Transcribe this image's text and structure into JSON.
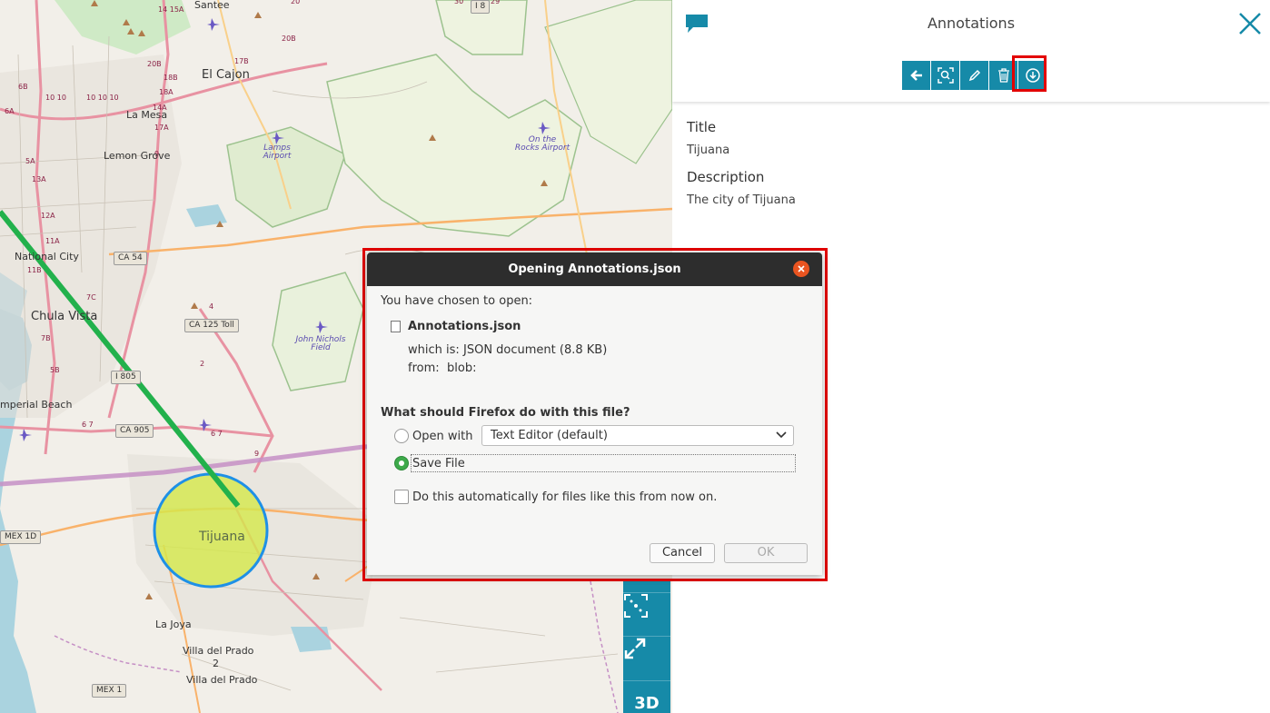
{
  "map": {
    "places": [
      {
        "id": "santee",
        "text": "Santee"
      },
      {
        "id": "el-cajon",
        "text": "El Cajon"
      },
      {
        "id": "la-mesa",
        "text": "La Mesa"
      },
      {
        "id": "lemon-grove",
        "text": "Lemon Grove"
      },
      {
        "id": "national-city",
        "text": "National City"
      },
      {
        "id": "chula-vista",
        "text": "Chula Vista"
      },
      {
        "id": "imperial-beach",
        "text": "mperial Beach"
      },
      {
        "id": "tijuana",
        "text": "Tijuana"
      },
      {
        "id": "la-joya",
        "text": "La Joya"
      },
      {
        "id": "villa-del-prado",
        "text": "Villa del Prado"
      },
      {
        "id": "villa-del-prado-2",
        "text": "Villa del Prado"
      },
      {
        "id": "villa-2",
        "text": "2"
      }
    ],
    "airports": [
      {
        "id": "lamps",
        "text": "Lamps\nAirport"
      },
      {
        "id": "on-the-rocks",
        "text": "On the\nRocks Airport"
      },
      {
        "id": "john-nichols",
        "text": "John Nichols\nField"
      }
    ],
    "shields": [
      "CA 54",
      "CA 125 Toll",
      "CA 905",
      "MEX 1D",
      "MEX 1",
      "I 8",
      "I 805"
    ],
    "tools": {
      "label_3d": "3D"
    }
  },
  "panel": {
    "title": "Annotations",
    "toolbar": [
      "back-icon",
      "zoom-to-icon",
      "edit-icon",
      "delete-icon",
      "download-icon"
    ],
    "fields": {
      "title_label": "Title",
      "title_value": "Tijuana",
      "description_label": "Description",
      "description_value": "The city of Tijuana"
    }
  },
  "dialog": {
    "title": "Opening Annotations.json",
    "intro": "You have chosen to open:",
    "filename": "Annotations.json",
    "which_is_label": "which is:",
    "which_is_value": "JSON document (8.8 KB)",
    "from_label": "from:",
    "from_value": "blob:",
    "question": "What should Firefox do with this file?",
    "open_with_label": "Open with",
    "open_with_value": "Text Editor (default)",
    "save_file_label": "Save File",
    "auto_label": "Do this automatically for files like this from now on.",
    "cancel": "Cancel",
    "ok": "OK",
    "selected_option": "save-file",
    "auto_checked": false
  },
  "colors": {
    "teal": "#168aa8",
    "highlight": "#e30000",
    "route": "#22b14c",
    "circle_fill": "#d4e84a",
    "circle_stroke": "#1e90e6",
    "radio_on": "#3daa4a",
    "dialog_close": "#e95420"
  }
}
